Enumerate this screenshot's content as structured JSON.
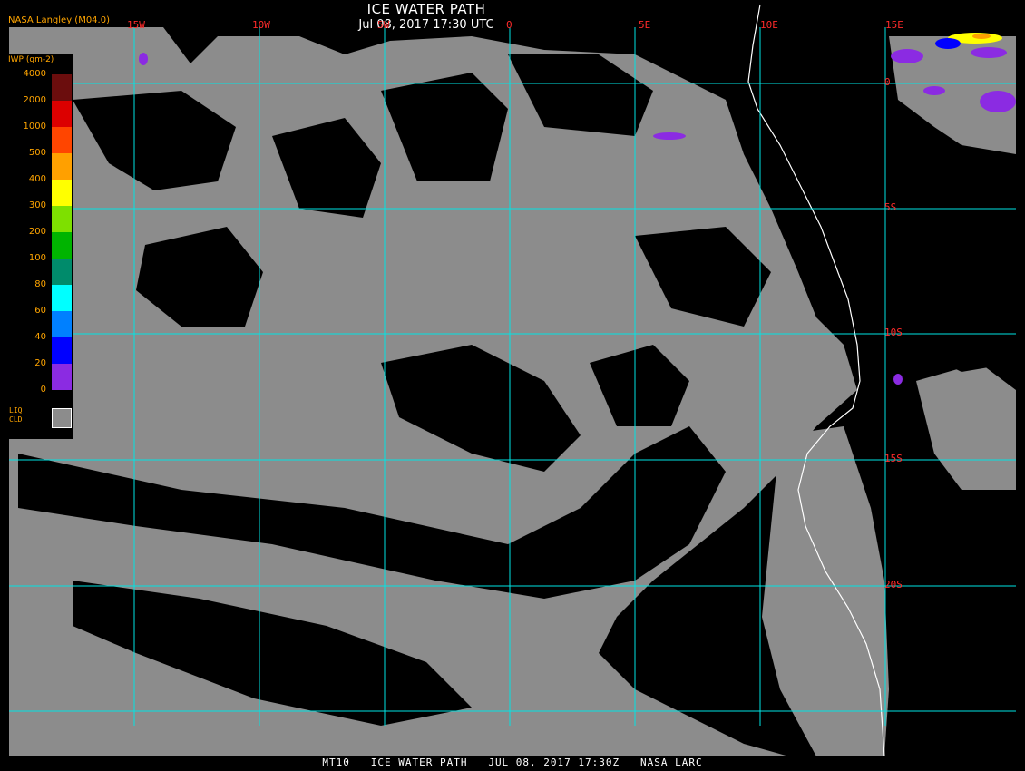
{
  "title": "ICE WATER PATH",
  "subtitle": "Jul 08, 2017 17:30 UTC",
  "agency": "NASA Langley (M04.0)",
  "footer": "MT10   ICE WATER PATH   JUL 08, 2017 17:30Z   NASA LARC",
  "legend": {
    "title": "IWP (gm-2)",
    "stops": [
      {
        "label": "4000",
        "color": "#6b0d0d"
      },
      {
        "label": "2000",
        "color": "#dc0000"
      },
      {
        "label": "1000",
        "color": "#ff4500"
      },
      {
        "label": "500",
        "color": "#ffa000"
      },
      {
        "label": "400",
        "color": "#ffff00"
      },
      {
        "label": "300",
        "color": "#7ee000"
      },
      {
        "label": "200",
        "color": "#00b400"
      },
      {
        "label": "100",
        "color": "#008b6b"
      },
      {
        "label": "80",
        "color": "#00ffff"
      },
      {
        "label": "60",
        "color": "#0080ff"
      },
      {
        "label": "40",
        "color": "#0000ff"
      },
      {
        "label": "20",
        "color": "#8b2be2"
      },
      {
        "label": "0",
        "color": ""
      }
    ],
    "liquid_label": [
      "LIQ",
      "CLD"
    ],
    "liquid_color": "#8c8c8c"
  },
  "longitude_labels": [
    "15W",
    "10W",
    "5W",
    "0",
    "5E",
    "10E",
    "15E"
  ],
  "latitude_labels": [
    "0",
    "5S",
    "10S",
    "15S",
    "20S"
  ],
  "colors": {
    "grid": "#00e5e5",
    "coast": "#ffffff",
    "liquid_cloud": "#8c8c8c",
    "background": "#000000"
  }
}
